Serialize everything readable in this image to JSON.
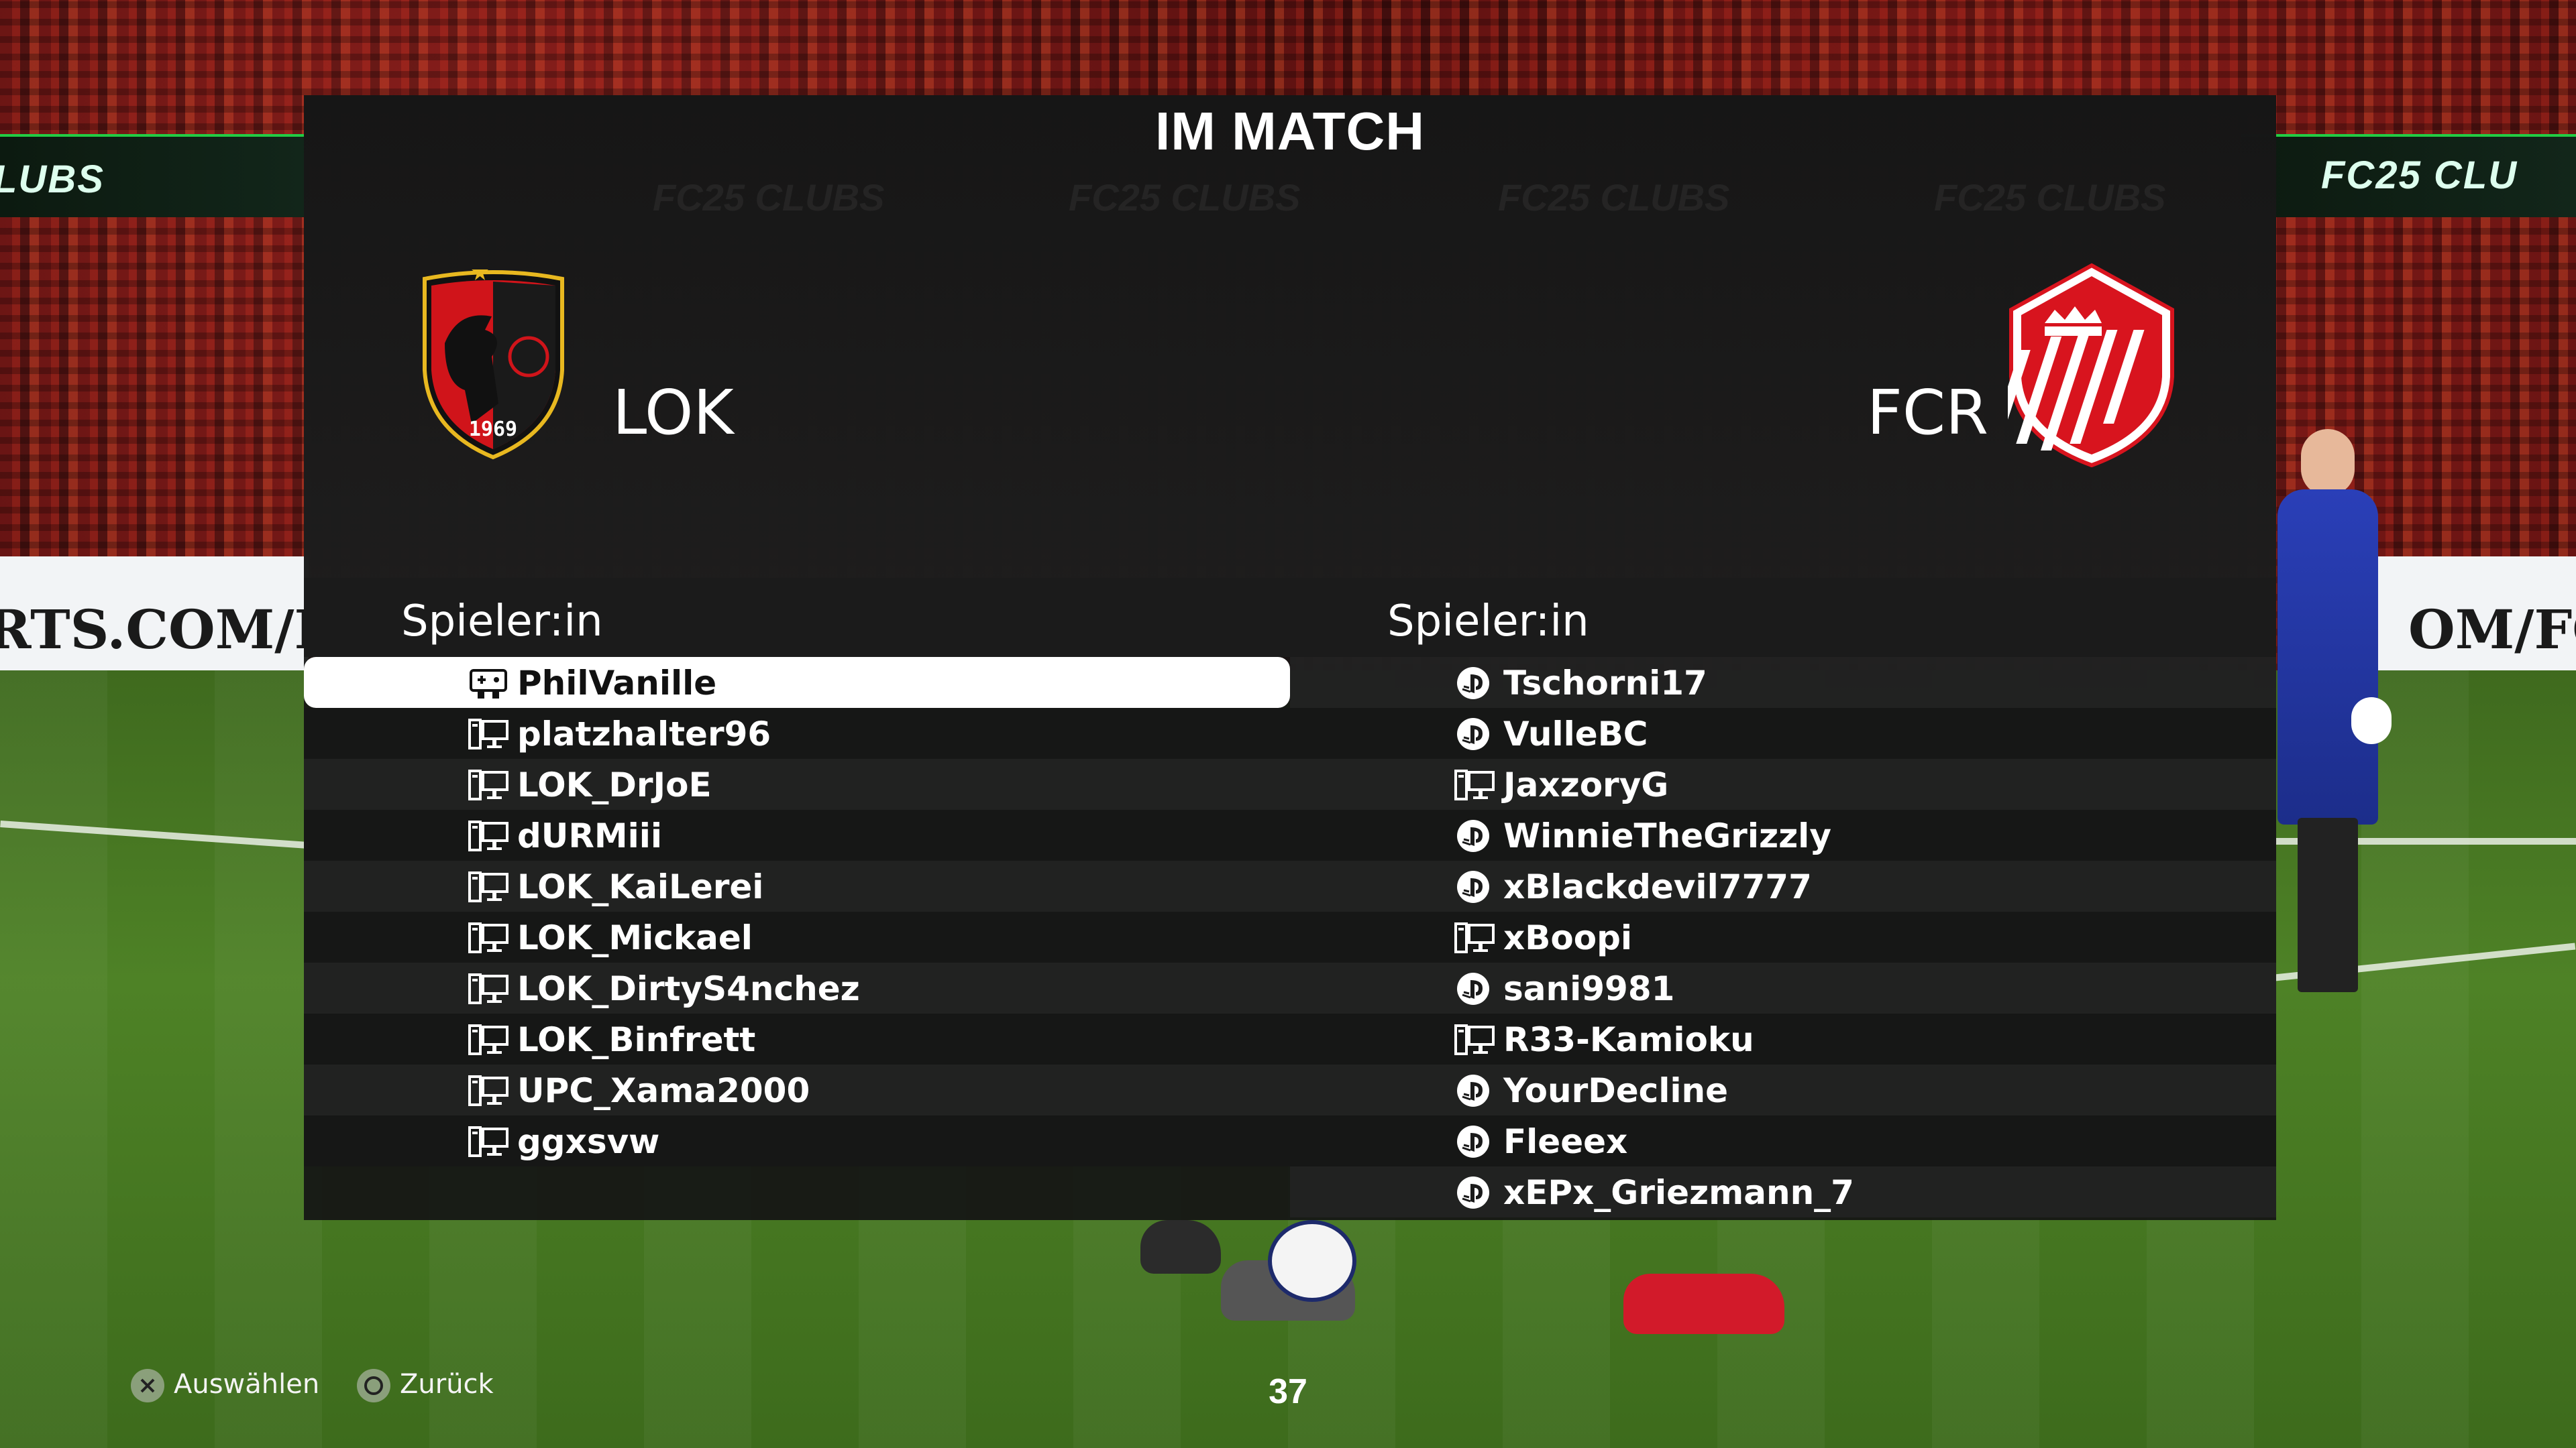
{
  "screen_title": "IM MATCH",
  "home": {
    "abbr": "LOK",
    "crest_year": "1969",
    "colors": {
      "primary": "#d0141a",
      "secondary": "#111111",
      "accent": "#f2c21b"
    }
  },
  "away": {
    "abbr": "FCR",
    "colors": {
      "primary": "#d8141e",
      "secondary": "#ffffff"
    }
  },
  "players_header": "Spieler:in",
  "home_players": [
    {
      "name": "PhilVanille",
      "icon": "controller-icon",
      "selected": true
    },
    {
      "name": "platzhalter96",
      "icon": "pc-icon"
    },
    {
      "name": "LOK_DrJoE",
      "icon": "pc-icon"
    },
    {
      "name": "dURMiii",
      "icon": "pc-icon"
    },
    {
      "name": "LOK_KaiLerei",
      "icon": "pc-icon"
    },
    {
      "name": "LOK_Mickael",
      "icon": "pc-icon"
    },
    {
      "name": "LOK_DirtyS4nchez",
      "icon": "pc-icon"
    },
    {
      "name": "LOK_Binfrett",
      "icon": "pc-icon"
    },
    {
      "name": "UPC_Xama2000",
      "icon": "pc-icon"
    },
    {
      "name": "ggxsvw",
      "icon": "pc-icon"
    }
  ],
  "away_players": [
    {
      "name": "Tschorni17",
      "icon": "playstation-icon"
    },
    {
      "name": "VulleBC",
      "icon": "playstation-icon"
    },
    {
      "name": "JaxzoryG",
      "icon": "pc-icon"
    },
    {
      "name": "WinnieTheGrizzly",
      "icon": "playstation-icon"
    },
    {
      "name": "xBlackdevil7777",
      "icon": "playstation-icon"
    },
    {
      "name": "xBoopi",
      "icon": "pc-icon"
    },
    {
      "name": "sani9981",
      "icon": "playstation-icon"
    },
    {
      "name": "R33-Kamioku",
      "icon": "pc-icon"
    },
    {
      "name": "YourDecline",
      "icon": "playstation-icon"
    },
    {
      "name": "Fleeex",
      "icon": "playstation-icon"
    },
    {
      "name": "xEPx_Griezmann_7",
      "icon": "playstation-icon"
    }
  ],
  "footer": {
    "select_label": "Auswählen",
    "back_label": "Zurück",
    "page_number": "37"
  },
  "background": {
    "board_text_left": "LUBS",
    "board_text_right": "FC25 CLU",
    "lower_board_left": "RTS.COM/FC",
    "lower_board_right": "OM/FC"
  }
}
